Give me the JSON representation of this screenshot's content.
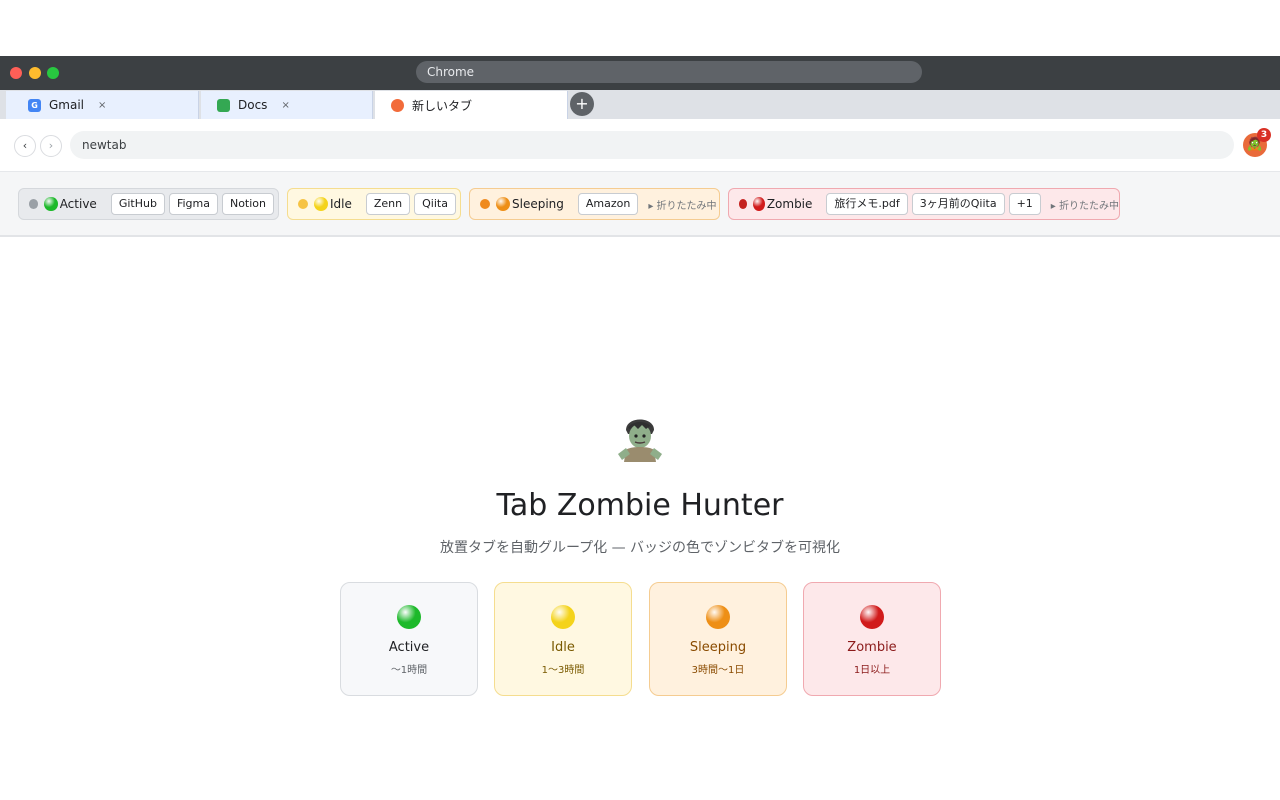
{
  "window": {
    "title": "Chrome"
  },
  "tabs": [
    {
      "label": "Gmail",
      "icon": "gmail-icon",
      "icon_letter": "G",
      "icon_color": "#4285f4",
      "close": "×"
    },
    {
      "label": "Docs",
      "icon": "docs-icon",
      "icon_color": "#34a853",
      "close": "×"
    },
    {
      "label": "新しいタブ",
      "icon": "zombie-hunter-icon",
      "icon_color": "#f26b3a"
    }
  ],
  "new_tab_label": "+",
  "toolbar": {
    "back": "‹",
    "forward": "›",
    "address": "newtab",
    "profile_badge": "3"
  },
  "groups": [
    {
      "label": "Active",
      "dot_color": "#9aa0a6",
      "orb_color": "#1db92a",
      "bg": "#e8eaed",
      "border": "#d5d8dc",
      "chips": [
        "GitHub",
        "Figma",
        "Notion"
      ],
      "collapsed": ""
    },
    {
      "label": "Idle",
      "dot_color": "#f6c343",
      "orb_color": "#f4d31b",
      "bg": "#fff8e1",
      "border": "#f5dd8f",
      "chips": [
        "Zenn",
        "Qiita"
      ],
      "collapsed": ""
    },
    {
      "label": "Sleeping",
      "dot_color": "#ef8a1e",
      "orb_color": "#ee8f16",
      "bg": "#fff1de",
      "border": "#f5cc91",
      "chips": [
        "Amazon"
      ],
      "collapsed": "▸ 折りたたみ中"
    },
    {
      "label": "Zombie",
      "dot_color": "#c5221f",
      "orb_color": "#d11b1b",
      "bg": "#fde8ea",
      "border": "#f0a9b0",
      "chips": [
        "旅行メモ.pdf",
        "3ヶ月前のQiita",
        "+1"
      ],
      "collapsed": "▸ 折りたたみ中"
    }
  ],
  "main": {
    "title": "Tab Zombie Hunter",
    "subtitle": "放置タブを自動グループ化 — バッジの色でゾンビタブを可視化"
  },
  "cards": [
    {
      "name": "Active",
      "range": "〜1時間",
      "orb_color": "#1db92a",
      "bg": "#f7f8fa",
      "border": "#d9dce0",
      "name_color": "#202124",
      "range_color": "#5f6368"
    },
    {
      "name": "Idle",
      "range": "1〜3時間",
      "orb_color": "#f4d31b",
      "bg": "#fff8e1",
      "border": "#f5dd8f",
      "name_color": "#7a5a00",
      "range_color": "#7a5a00"
    },
    {
      "name": "Sleeping",
      "range": "3時間〜1日",
      "orb_color": "#ee8f16",
      "bg": "#fff1de",
      "border": "#f5cc91",
      "name_color": "#8a4b00",
      "range_color": "#8a4b00"
    },
    {
      "name": "Zombie",
      "range": "1日以上",
      "orb_color": "#d11b1b",
      "bg": "#fde8ea",
      "border": "#f0a9b0",
      "name_color": "#8b1a1a",
      "range_color": "#8b1a1a"
    }
  ]
}
